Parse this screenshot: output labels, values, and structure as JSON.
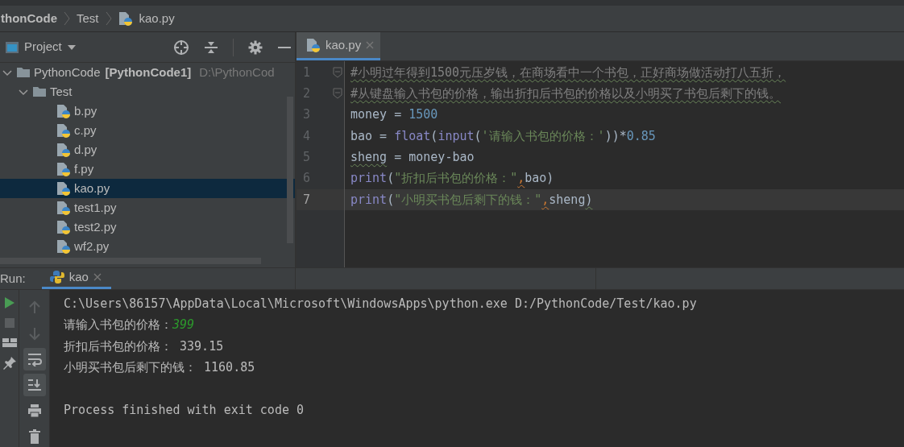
{
  "breadcrumb": [
    "thonCode",
    "Test",
    "kao.py"
  ],
  "project_panel": {
    "title": "Project"
  },
  "tree": [
    {
      "label": "PythonCode",
      "module": "[PythonCode1]",
      "path": "D:\\PythonCod",
      "kind": "folder",
      "expanded": true,
      "selected": false,
      "children": [
        {
          "label": "Test",
          "kind": "folder",
          "expanded": true,
          "selected": false,
          "children": [
            {
              "label": "b.py",
              "kind": "python",
              "selected": false
            },
            {
              "label": "c.py",
              "kind": "python",
              "selected": false
            },
            {
              "label": "d.py",
              "kind": "python",
              "selected": false
            },
            {
              "label": "f.py",
              "kind": "python",
              "selected": false
            },
            {
              "label": "kao.py",
              "kind": "python",
              "selected": true
            },
            {
              "label": "test1.py",
              "kind": "python",
              "selected": false
            },
            {
              "label": "test2.py",
              "kind": "python",
              "selected": false
            },
            {
              "label": "wf2.py",
              "kind": "python",
              "selected": false
            }
          ]
        }
      ]
    }
  ],
  "editor_tabs": [
    {
      "label": "kao.py",
      "selected": true
    }
  ],
  "code": [
    {
      "number": "1",
      "fold": true,
      "current": false,
      "tokens": [
        {
          "kind": "comment",
          "text": "#小明过年得到1500元压岁钱，在商场看中一个书包，正好商场做活动打八五折，",
          "squiggle": true
        }
      ]
    },
    {
      "number": "2",
      "fold": true,
      "current": false,
      "tokens": [
        {
          "kind": "comment",
          "text": "#从键盘输入书包的价格，输出折扣后书包的价格以及小明买了书包后剩下的钱。",
          "squiggle": true
        }
      ]
    },
    {
      "number": "3",
      "fold": false,
      "current": false,
      "tokens": [
        {
          "kind": "ident",
          "text": "money = "
        },
        {
          "kind": "number",
          "text": "1500"
        }
      ]
    },
    {
      "number": "4",
      "fold": false,
      "current": false,
      "tokens": [
        {
          "kind": "ident",
          "text": "bao = "
        },
        {
          "kind": "builtin",
          "text": "float"
        },
        {
          "kind": "ident",
          "text": "("
        },
        {
          "kind": "builtin",
          "text": "input"
        },
        {
          "kind": "ident",
          "text": "("
        },
        {
          "kind": "string",
          "text": "'请输入书包的价格：'"
        },
        {
          "kind": "ident",
          "text": "))*"
        },
        {
          "kind": "number",
          "text": "0.85"
        }
      ]
    },
    {
      "number": "5",
      "fold": false,
      "current": false,
      "tokens": [
        {
          "kind": "ident",
          "text": "sheng",
          "squiggle": true
        },
        {
          "kind": "ident",
          "text": " = money-bao"
        }
      ]
    },
    {
      "number": "6",
      "fold": false,
      "current": false,
      "tokens": [
        {
          "kind": "builtin",
          "text": "print"
        },
        {
          "kind": "ident",
          "text": "("
        },
        {
          "kind": "string",
          "text": "\"折扣后书包的价格：\""
        },
        {
          "kind": "comma",
          "text": ",",
          "squiggle": true
        },
        {
          "kind": "ident",
          "text": "bao)"
        }
      ]
    },
    {
      "number": "7",
      "fold": false,
      "current": true,
      "tokens": [
        {
          "kind": "builtin",
          "text": "print"
        },
        {
          "kind": "ident",
          "text": "("
        },
        {
          "kind": "string",
          "text": "\"小明买书包后剩下的钱：\""
        },
        {
          "kind": "comma",
          "text": ",",
          "squiggle": true
        },
        {
          "kind": "ident",
          "text": "sheng"
        },
        {
          "kind": "ident",
          "text": ")",
          "squiggle": true
        }
      ]
    }
  ],
  "run_panel": {
    "label": "Run:",
    "tabs": [
      {
        "label": "kao",
        "selected": true
      }
    ]
  },
  "console": [
    {
      "kind": "line",
      "segments": [
        {
          "kind": "output",
          "text": "C:\\Users\\86157\\AppData\\Local\\Microsoft\\WindowsApps\\python.exe D:/PythonCode/Test/kao.py"
        }
      ]
    },
    {
      "kind": "line",
      "segments": [
        {
          "kind": "output",
          "text": "请输入书包的价格："
        },
        {
          "kind": "input",
          "text": "399"
        }
      ]
    },
    {
      "kind": "line",
      "segments": [
        {
          "kind": "output",
          "text": "折扣后书包的价格： 339.15"
        }
      ]
    },
    {
      "kind": "line",
      "segments": [
        {
          "kind": "output",
          "text": "小明买书包后剩下的钱： 1160.85"
        }
      ]
    },
    {
      "kind": "blank"
    },
    {
      "kind": "line",
      "segments": [
        {
          "kind": "output",
          "text": "Process finished with exit code 0"
        }
      ]
    }
  ]
}
